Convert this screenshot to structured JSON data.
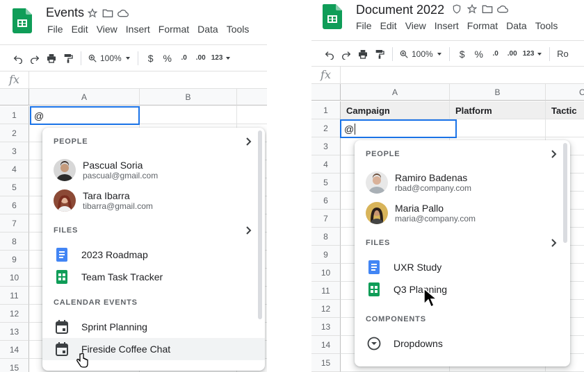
{
  "left": {
    "doc_title": "Events",
    "menu": [
      "File",
      "Edit",
      "View",
      "Insert",
      "Format",
      "Data",
      "Tools"
    ],
    "zoom": "100%",
    "toolbar_labels": {
      "currency": "$",
      "percent": "%",
      "dec_less": ".0",
      "dec_more": ".00",
      "format_123": "123"
    },
    "fx": "fx",
    "columns": [
      "A",
      "B"
    ],
    "rows": [
      "1",
      "2",
      "3",
      "4",
      "5",
      "6",
      "7",
      "8",
      "9",
      "10",
      "11",
      "12",
      "13",
      "14",
      "15"
    ],
    "active_cell_value": "@",
    "popup": {
      "people_header": "PEOPLE",
      "people": [
        {
          "name": "Pascual Soria",
          "email": "pascual@gmail.com"
        },
        {
          "name": "Tara Ibarra",
          "email": "tibarra@gmail.com"
        }
      ],
      "files_header": "FILES",
      "files": [
        {
          "label": "2023 Roadmap",
          "icon": "docs-icon"
        },
        {
          "label": "Team Task Tracker",
          "icon": "sheets-icon"
        }
      ],
      "calendar_header": "CALENDAR EVENTS",
      "events": [
        {
          "label": "Sprint Planning"
        },
        {
          "label": "Fireside Coffee Chat"
        }
      ]
    }
  },
  "right": {
    "doc_title": "Document 2022",
    "menu": [
      "File",
      "Edit",
      "View",
      "Insert",
      "Format",
      "Data",
      "Tools"
    ],
    "zoom": "100%",
    "toolbar_labels": {
      "currency": "$",
      "percent": "%",
      "dec_less": ".0",
      "dec_more": ".00",
      "format_123": "123",
      "font": "Ro"
    },
    "fx": "fx",
    "columns": [
      "A",
      "B",
      "C"
    ],
    "rows": [
      "1",
      "2",
      "3",
      "4",
      "5",
      "6",
      "7",
      "8",
      "9",
      "10",
      "11",
      "12",
      "13",
      "14",
      "15"
    ],
    "header_cells": [
      "Campaign",
      "Platform",
      "Tactic"
    ],
    "active_cell_value": "@",
    "popup": {
      "people_header": "PEOPLE",
      "people": [
        {
          "name": "Ramiro Badenas",
          "email": "rbad@company.com"
        },
        {
          "name": "Maria Pallo",
          "email": "maria@company.com"
        }
      ],
      "files_header": "FILES",
      "files": [
        {
          "label": "UXR Study",
          "icon": "docs-icon"
        },
        {
          "label": "Q3 Planning",
          "icon": "sheets-icon"
        }
      ],
      "components_header": "COMPONENTS",
      "components": [
        {
          "label": "Dropdowns",
          "icon": "dropdown-icon"
        }
      ]
    }
  },
  "colors": {
    "sheets_green": "#0f9d58",
    "docs_blue": "#4285f4",
    "selection_blue": "#1a73e8"
  }
}
